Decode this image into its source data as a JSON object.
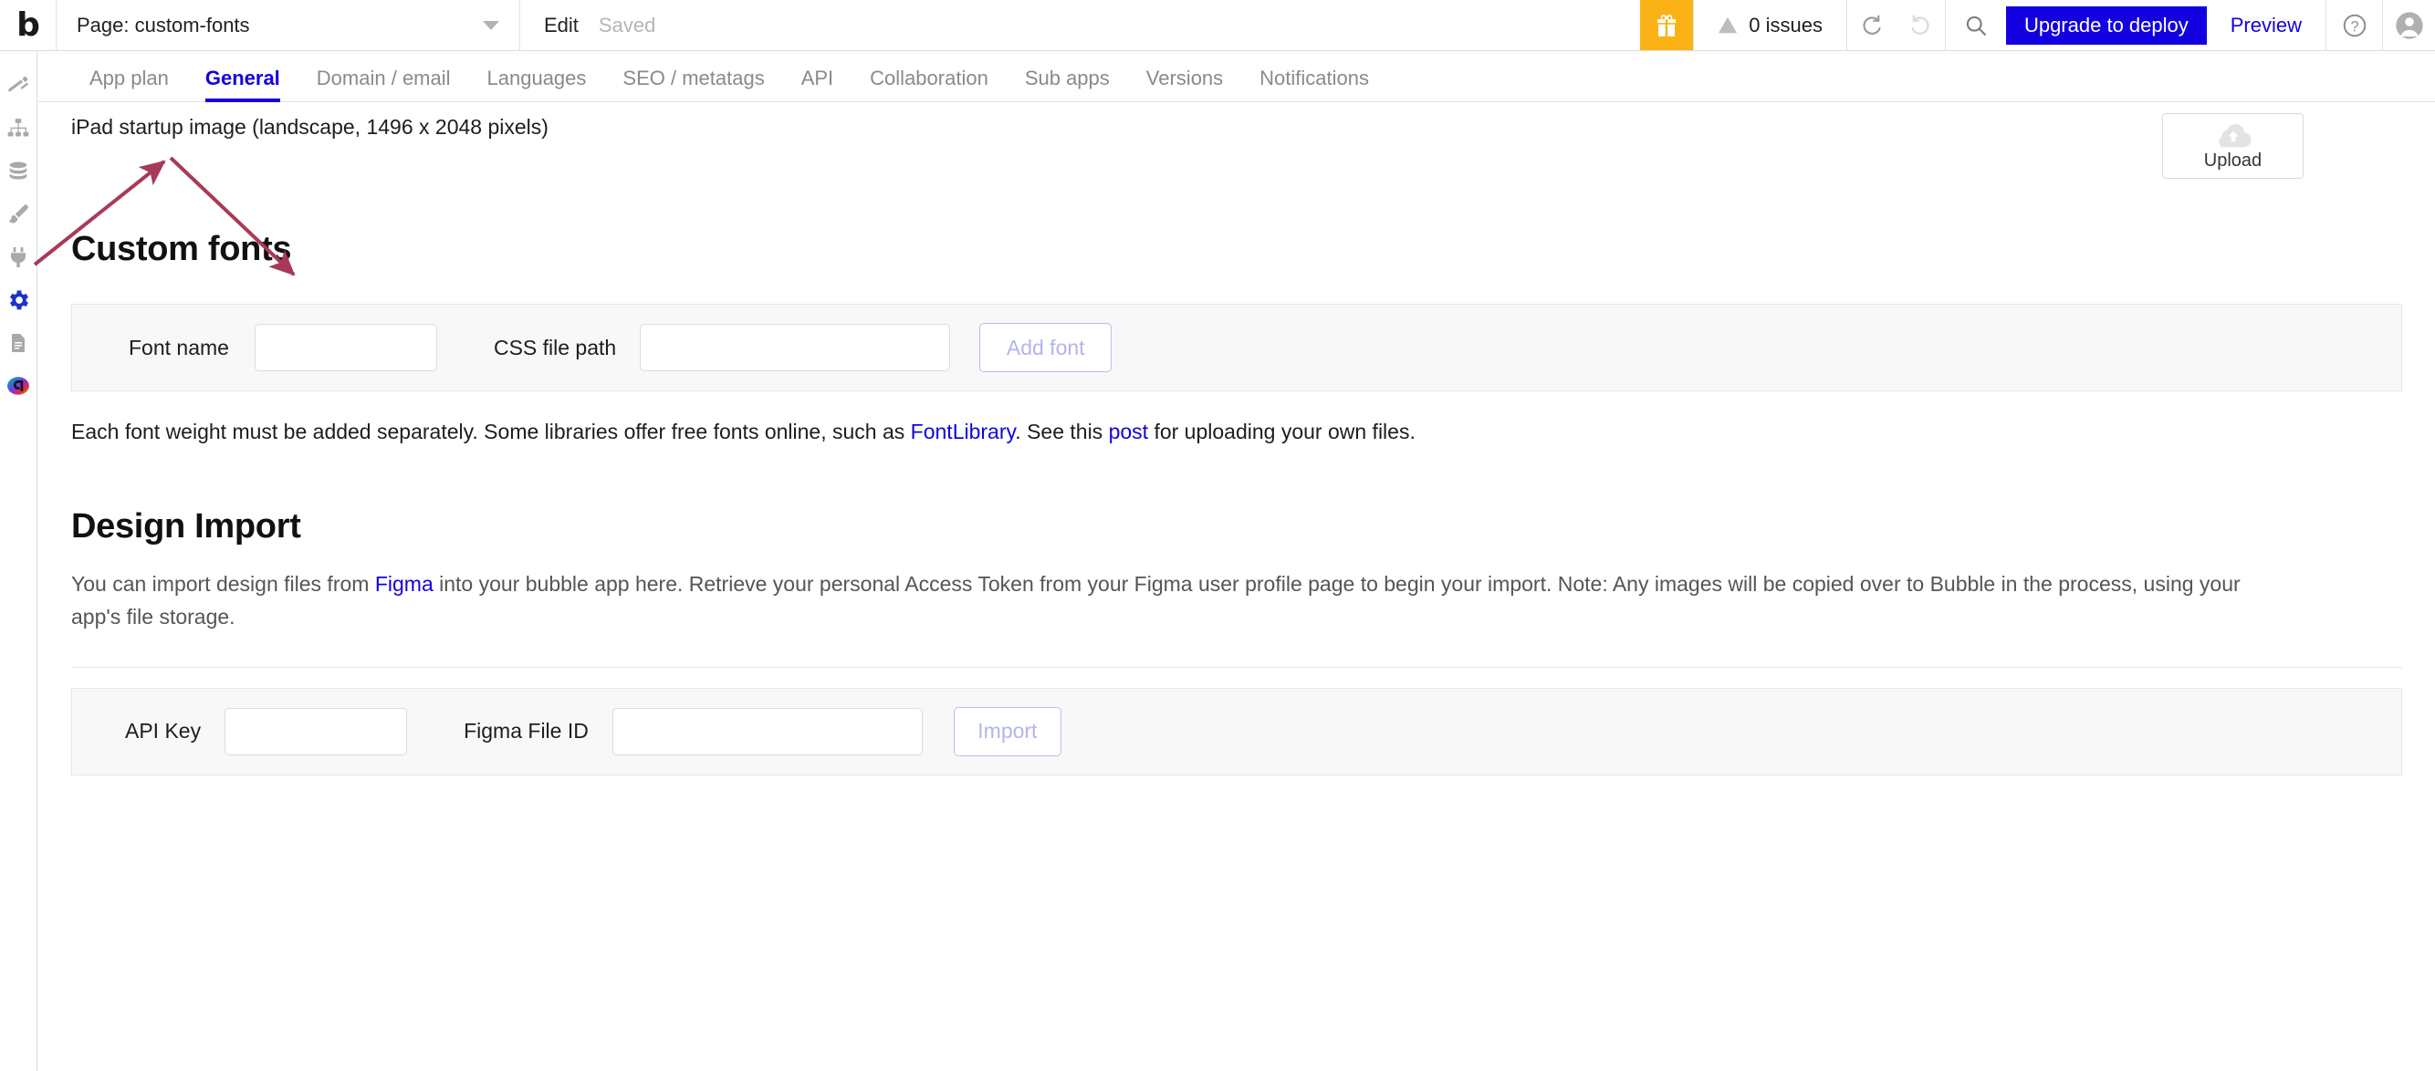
{
  "topbar": {
    "logo": "b",
    "page_selector_label": "Page: custom-fonts",
    "edit_label": "Edit",
    "saved_label": "Saved",
    "gift_icon": "gift-icon",
    "issues_label": "0 issues",
    "undo_icon": "undo-icon",
    "redo_icon": "redo-icon",
    "search_icon": "search-icon",
    "upgrade_label": "Upgrade to deploy",
    "preview_label": "Preview",
    "help_icon": "help-circle-icon",
    "avatar_icon": "user-avatar-icon"
  },
  "sidebar": {
    "items": [
      {
        "name": "design",
        "icon": "pencil-ruler-icon",
        "active": false
      },
      {
        "name": "workflow",
        "icon": "hierarchy-icon",
        "active": false
      },
      {
        "name": "data",
        "icon": "database-icon",
        "active": false
      },
      {
        "name": "styles",
        "icon": "paintbrush-icon",
        "active": false
      },
      {
        "name": "plugins",
        "icon": "plug-icon",
        "active": false
      },
      {
        "name": "settings",
        "icon": "gear-icon",
        "active": true
      },
      {
        "name": "logs",
        "icon": "document-icon",
        "active": false
      },
      {
        "name": "app-badge",
        "icon": "app-logo-icon",
        "active": false
      }
    ]
  },
  "tabs": [
    {
      "label": "App plan",
      "active": false
    },
    {
      "label": "General",
      "active": true
    },
    {
      "label": "Domain / email",
      "active": false
    },
    {
      "label": "Languages",
      "active": false
    },
    {
      "label": "SEO / metatags",
      "active": false
    },
    {
      "label": "API",
      "active": false
    },
    {
      "label": "Collaboration",
      "active": false
    },
    {
      "label": "Sub apps",
      "active": false
    },
    {
      "label": "Versions",
      "active": false
    },
    {
      "label": "Notifications",
      "active": false
    }
  ],
  "main": {
    "startup_image_label": "iPad startup image (landscape, 1496 x 2048 pixels)",
    "upload_label": "Upload",
    "custom_fonts": {
      "heading": "Custom fonts",
      "font_name_label": "Font name",
      "font_name_value": "",
      "font_name_placeholder": "",
      "css_path_label": "CSS file path",
      "css_path_value": "",
      "css_path_placeholder": "",
      "add_font_label": "Add font",
      "helper_part1": "Each font weight must be added separately. Some libraries offer free fonts online, such as ",
      "helper_link1": "FontLibrary",
      "helper_part2": ". See this ",
      "helper_link2": "post",
      "helper_part3": " for uploading your own files."
    },
    "design_import": {
      "heading": "Design Import",
      "para_part1": "You can import design files from ",
      "para_link": "Figma",
      "para_part2": " into your bubble app here. Retrieve your personal Access Token from your Figma user profile page to begin your import. Note: Any images will be copied over to Bubble in the process, using your app's file storage.",
      "api_key_label": "API Key",
      "api_key_value": "",
      "api_key_placeholder": "",
      "figma_file_label": "Figma File ID",
      "figma_file_value": "",
      "figma_file_placeholder": "",
      "import_label": "Import"
    }
  },
  "colors": {
    "accent_blue": "#1300e0",
    "gift_yellow": "#fbb217",
    "annotation_red": "#a83a57",
    "muted_text": "#8a8a8a",
    "disabled_button": "#b4b4ec"
  },
  "annotations": {
    "arrow1_note": "arrow from settings gear icon to General tab",
    "arrow2_note": "arrow from General tab down to Font name input"
  }
}
